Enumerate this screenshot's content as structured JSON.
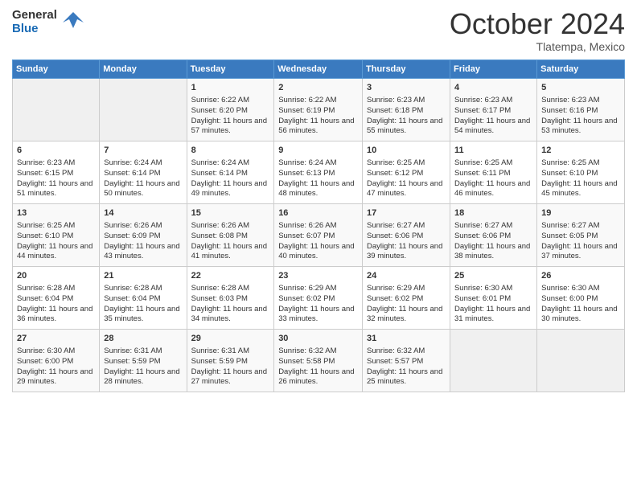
{
  "header": {
    "logo_general": "General",
    "logo_blue": "Blue",
    "month_title": "October 2024",
    "subtitle": "Tlatempa, Mexico"
  },
  "days_of_week": [
    "Sunday",
    "Monday",
    "Tuesday",
    "Wednesday",
    "Thursday",
    "Friday",
    "Saturday"
  ],
  "weeks": [
    [
      {
        "day": "",
        "empty": true
      },
      {
        "day": "",
        "empty": true
      },
      {
        "day": "1",
        "sunrise": "6:22 AM",
        "sunset": "6:20 PM",
        "daylight": "11 hours and 57 minutes."
      },
      {
        "day": "2",
        "sunrise": "6:22 AM",
        "sunset": "6:19 PM",
        "daylight": "11 hours and 56 minutes."
      },
      {
        "day": "3",
        "sunrise": "6:23 AM",
        "sunset": "6:18 PM",
        "daylight": "11 hours and 55 minutes."
      },
      {
        "day": "4",
        "sunrise": "6:23 AM",
        "sunset": "6:17 PM",
        "daylight": "11 hours and 54 minutes."
      },
      {
        "day": "5",
        "sunrise": "6:23 AM",
        "sunset": "6:16 PM",
        "daylight": "11 hours and 53 minutes."
      }
    ],
    [
      {
        "day": "6",
        "sunrise": "6:23 AM",
        "sunset": "6:15 PM",
        "daylight": "11 hours and 51 minutes."
      },
      {
        "day": "7",
        "sunrise": "6:24 AM",
        "sunset": "6:14 PM",
        "daylight": "11 hours and 50 minutes."
      },
      {
        "day": "8",
        "sunrise": "6:24 AM",
        "sunset": "6:14 PM",
        "daylight": "11 hours and 49 minutes."
      },
      {
        "day": "9",
        "sunrise": "6:24 AM",
        "sunset": "6:13 PM",
        "daylight": "11 hours and 48 minutes."
      },
      {
        "day": "10",
        "sunrise": "6:25 AM",
        "sunset": "6:12 PM",
        "daylight": "11 hours and 47 minutes."
      },
      {
        "day": "11",
        "sunrise": "6:25 AM",
        "sunset": "6:11 PM",
        "daylight": "11 hours and 46 minutes."
      },
      {
        "day": "12",
        "sunrise": "6:25 AM",
        "sunset": "6:10 PM",
        "daylight": "11 hours and 45 minutes."
      }
    ],
    [
      {
        "day": "13",
        "sunrise": "6:25 AM",
        "sunset": "6:10 PM",
        "daylight": "11 hours and 44 minutes."
      },
      {
        "day": "14",
        "sunrise": "6:26 AM",
        "sunset": "6:09 PM",
        "daylight": "11 hours and 43 minutes."
      },
      {
        "day": "15",
        "sunrise": "6:26 AM",
        "sunset": "6:08 PM",
        "daylight": "11 hours and 41 minutes."
      },
      {
        "day": "16",
        "sunrise": "6:26 AM",
        "sunset": "6:07 PM",
        "daylight": "11 hours and 40 minutes."
      },
      {
        "day": "17",
        "sunrise": "6:27 AM",
        "sunset": "6:06 PM",
        "daylight": "11 hours and 39 minutes."
      },
      {
        "day": "18",
        "sunrise": "6:27 AM",
        "sunset": "6:06 PM",
        "daylight": "11 hours and 38 minutes."
      },
      {
        "day": "19",
        "sunrise": "6:27 AM",
        "sunset": "6:05 PM",
        "daylight": "11 hours and 37 minutes."
      }
    ],
    [
      {
        "day": "20",
        "sunrise": "6:28 AM",
        "sunset": "6:04 PM",
        "daylight": "11 hours and 36 minutes."
      },
      {
        "day": "21",
        "sunrise": "6:28 AM",
        "sunset": "6:04 PM",
        "daylight": "11 hours and 35 minutes."
      },
      {
        "day": "22",
        "sunrise": "6:28 AM",
        "sunset": "6:03 PM",
        "daylight": "11 hours and 34 minutes."
      },
      {
        "day": "23",
        "sunrise": "6:29 AM",
        "sunset": "6:02 PM",
        "daylight": "11 hours and 33 minutes."
      },
      {
        "day": "24",
        "sunrise": "6:29 AM",
        "sunset": "6:02 PM",
        "daylight": "11 hours and 32 minutes."
      },
      {
        "day": "25",
        "sunrise": "6:30 AM",
        "sunset": "6:01 PM",
        "daylight": "11 hours and 31 minutes."
      },
      {
        "day": "26",
        "sunrise": "6:30 AM",
        "sunset": "6:00 PM",
        "daylight": "11 hours and 30 minutes."
      }
    ],
    [
      {
        "day": "27",
        "sunrise": "6:30 AM",
        "sunset": "6:00 PM",
        "daylight": "11 hours and 29 minutes."
      },
      {
        "day": "28",
        "sunrise": "6:31 AM",
        "sunset": "5:59 PM",
        "daylight": "11 hours and 28 minutes."
      },
      {
        "day": "29",
        "sunrise": "6:31 AM",
        "sunset": "5:59 PM",
        "daylight": "11 hours and 27 minutes."
      },
      {
        "day": "30",
        "sunrise": "6:32 AM",
        "sunset": "5:58 PM",
        "daylight": "11 hours and 26 minutes."
      },
      {
        "day": "31",
        "sunrise": "6:32 AM",
        "sunset": "5:57 PM",
        "daylight": "11 hours and 25 minutes."
      },
      {
        "day": "",
        "empty": true
      },
      {
        "day": "",
        "empty": true
      }
    ]
  ]
}
